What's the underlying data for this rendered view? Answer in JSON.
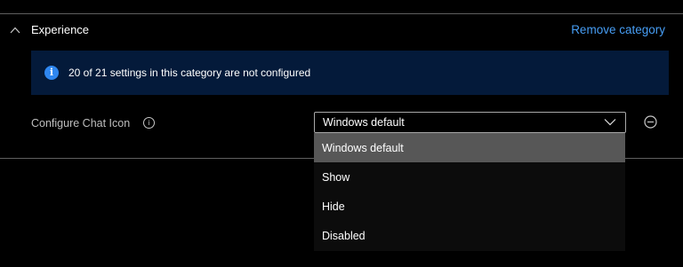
{
  "section": {
    "title": "Experience",
    "remove_label": "Remove category",
    "expanded": true
  },
  "info_banner": {
    "icon": "info-icon",
    "glyph": "i",
    "text": "20 of 21 settings in this category are not configured"
  },
  "setting": {
    "label": "Configure Chat Icon",
    "help_glyph": "i",
    "selected_value": "Windows default",
    "options": [
      {
        "label": "Windows default",
        "selected": true
      },
      {
        "label": "Show",
        "selected": false
      },
      {
        "label": "Hide",
        "selected": false
      },
      {
        "label": "Disabled",
        "selected": false
      }
    ]
  },
  "colors": {
    "background": "#000000",
    "accent_link": "#479ef5",
    "banner_bg": "#041a3a",
    "info_icon": "#2f87f0",
    "selected_option": "#575757"
  }
}
